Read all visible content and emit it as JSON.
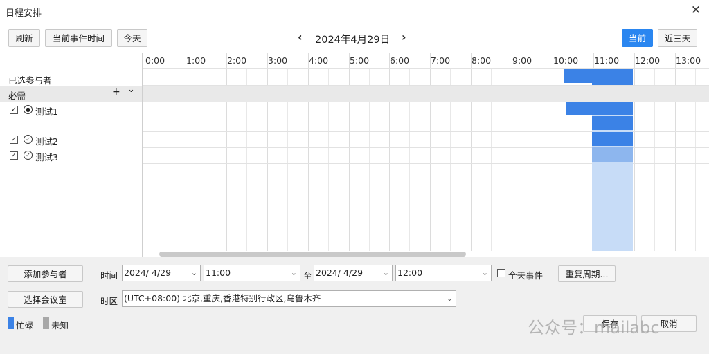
{
  "window": {
    "title": "日程安排",
    "close_glyph": "✕"
  },
  "toolbar": {
    "refresh": "刷新",
    "current_event_time": "当前事件时间",
    "today": "今天",
    "prev_glyph": "‹",
    "next_glyph": "›",
    "date": "2024年4月29日",
    "current": "当前",
    "recent_three_days": "近三天"
  },
  "grid": {
    "hours": [
      "0:00",
      "1:00",
      "2:00",
      "3:00",
      "4:00",
      "5:00",
      "6:00",
      "7:00",
      "8:00",
      "9:00",
      "10:00",
      "11:00",
      "12:00",
      "13:00"
    ],
    "rows": {
      "selected_attendees": "已选参与者",
      "required": "必需",
      "add_glyph": "+",
      "collapse_glyph": "⌄"
    },
    "attendees": [
      {
        "name": "测试1",
        "checked": true,
        "icon": "person-icon"
      },
      {
        "name": "测试2",
        "checked": true,
        "icon": "check-circle-icon"
      },
      {
        "name": "测试3",
        "checked": true,
        "icon": "check-circle-icon"
      }
    ],
    "colors": {
      "busy": "#3b82e6",
      "selection": "#c7dcf7",
      "accent": "#2a86f0",
      "unknown": "#a8a8a8"
    }
  },
  "form": {
    "add_attendee": "添加参与者",
    "select_room": "选择会议室",
    "time_label": "时间",
    "start_date": "2024/  4/29",
    "start_time": "11:00",
    "to_label": "至",
    "end_date": "2024/  4/29",
    "end_time": "12:00",
    "all_day": "全天事件",
    "all_day_checked": false,
    "repeat": "重复周期...",
    "tz_label": "时区",
    "timezone": "(UTC+08:00) 北京,重庆,香港特别行政区,乌鲁木齐",
    "dropdown_glyph": "⌄"
  },
  "legend": {
    "busy": "忙碌",
    "unknown": "未知"
  },
  "footer": {
    "save": "保存",
    "cancel": "取消",
    "watermark": "公众号：mailabc"
  }
}
